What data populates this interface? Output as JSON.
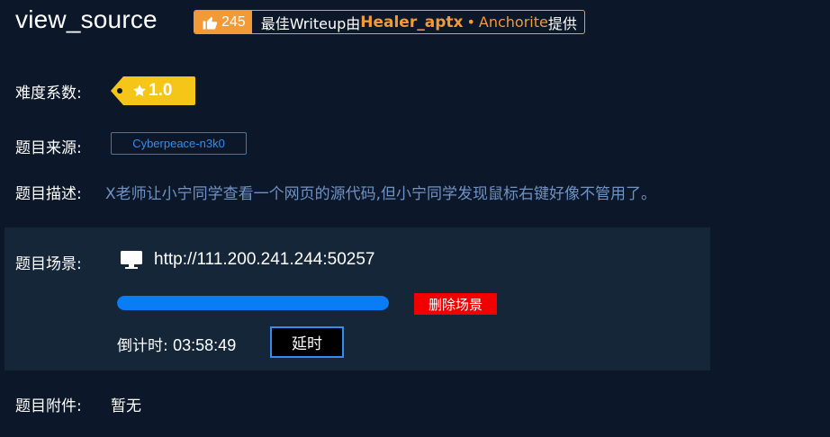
{
  "challenge": {
    "title": "view_source"
  },
  "writeup_badge": {
    "likes": "245",
    "text_prefix": "最佳Writeup由",
    "author": "Healer_aptx",
    "separator": "•",
    "team": "Anchorite",
    "text_suffix": "提供",
    "accent_color": "#f39a38"
  },
  "difficulty": {
    "label": "难度系数:",
    "value": "1.0",
    "icon": "star-icon",
    "tag_color": "#f5c518"
  },
  "source": {
    "label": "题目来源:",
    "value": "Cyberpeace-n3k0"
  },
  "description": {
    "label": "题目描述:",
    "text": "X老师让小宁同学查看一个网页的源代码,但小宁同学发现鼠标右键好像不管用了。"
  },
  "scene": {
    "label": "题目场景:",
    "icon": "monitor-icon",
    "url": "http://111.200.241.244:50257",
    "progress": 1.0,
    "delete_label": "删除场景",
    "countdown_label": "倒计时:",
    "countdown_value": "03:58:49",
    "extend_label": "延时",
    "progress_color": "#0a7cf5",
    "delete_color": "#f20000"
  },
  "attachment": {
    "label": "题目附件:",
    "value": "暂无"
  }
}
